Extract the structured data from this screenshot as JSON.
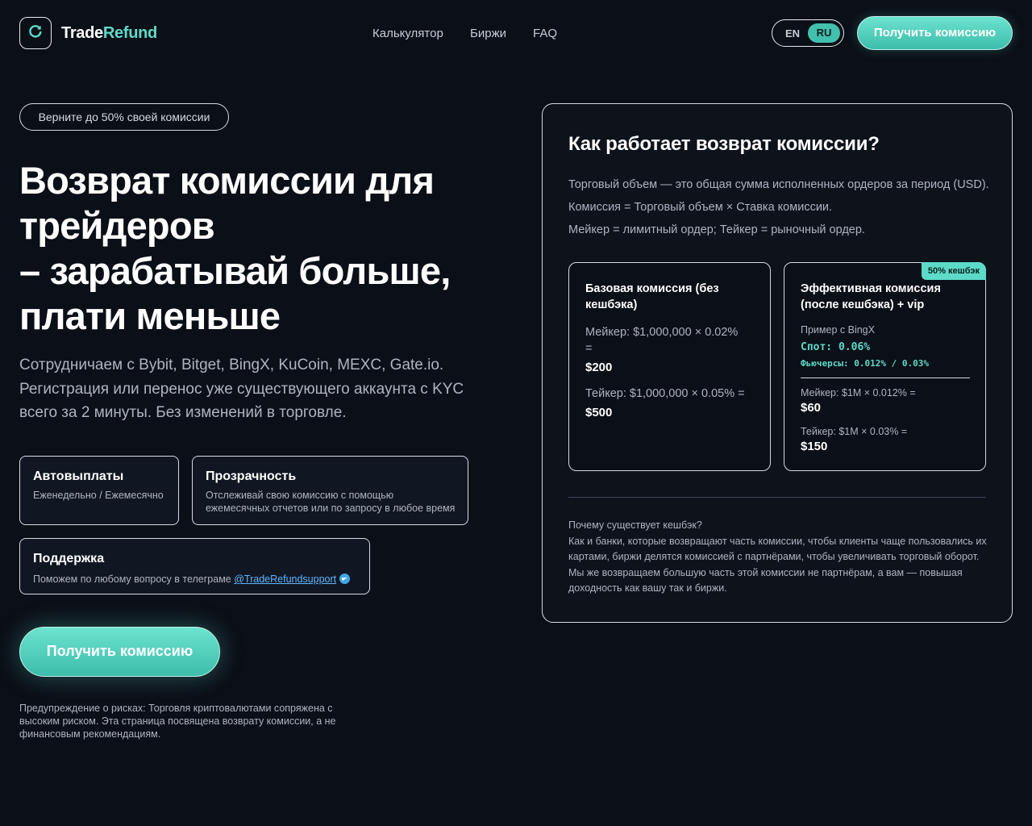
{
  "header": {
    "logo_icon": "refresh-icon",
    "logo_word1": "Trade",
    "logo_word2": "Refund",
    "nav": [
      "Калькулятор",
      "Биржи",
      "FAQ"
    ],
    "lang_en": "EN",
    "lang_ru": "RU",
    "cta": "Получить комиссию"
  },
  "colors": {
    "accent": "#5ddbc9",
    "background": "#0b0f17",
    "link": "#5db7ff"
  },
  "hero": {
    "badge": "Верните до 50% своей комиссии",
    "title_lines": [
      "Возврат комиссии для",
      "трейдеров",
      "– зарабатывай больше,",
      "плати меньше"
    ],
    "subtitle_lines": [
      "Сотрудничаем с Bybit, Bitget, BingX, KuCoin, MEXC, Gate.io.",
      "Регистрация или перенос уже существующего аккаунта с KYC",
      "всего за 2 минуты. Без изменений в торговле."
    ],
    "features": [
      {
        "title": "Автовыплаты",
        "subtitle": "Еженедельно / Ежемесячно"
      },
      {
        "title": "Прозрачность",
        "subtitle_lines": [
          "Отслеживай свою комиссию с помощью",
          "ежемесячных отчетов или по запросу в любое время"
        ]
      },
      {
        "title": "Поддержка",
        "subtitle": "Поможем по любому вопросу в телеграме",
        "link": "@TradeRefundsupport",
        "link_icon": "telegram-icon"
      }
    ],
    "cta": "Получить комиссию",
    "risk_lines": [
      "Предупреждение о рисках: Торговля криптовалютами сопряжена с",
      "высоким риском. Эта страница посвящена возврату комиссии, а не",
      "финансовым рекомендациям."
    ]
  },
  "panel": {
    "title": "Как работает возврат комиссии?",
    "lines": [
      "Торговый объем — это общая сумма исполненных ордеров за период (USD).",
      "Комиссия = Торговый объем × Ставка комиссии.",
      "Мейкер = лимитный ордер; Тейкер = рыночный ордер."
    ],
    "base_card": {
      "title_lines": [
        "Базовая комиссия (без",
        "кешбэка)"
      ],
      "maker_lines": [
        "Мейкер: $1,000,000 × 0.02%",
        "="
      ],
      "maker_value": "$200",
      "taker_line": "Тейкер: $1,000,000 × 0.05% =",
      "taker_value": "$500"
    },
    "effective_card": {
      "tag": "50% кешбэк",
      "title_lines": [
        "Эффективная комиссия",
        "(после кешбэка) + vip"
      ],
      "example": "Пример с BingX",
      "spot": "Спот: 0.06%",
      "futures": "Фьючерсы: 0.012% / 0.03%",
      "maker_line": "Мейкер: $1M × 0.012% =",
      "maker_value": "$60",
      "taker_line": "Тейкер: $1M × 0.03% =",
      "taker_value": "$150"
    },
    "why_title": "Почему существует кешбэк?",
    "why_lines": [
      "Как и банки, которые возвращают часть комиссии, чтобы клиенты чаще пользовались их",
      "картами, биржи делятся комиссией с партнёрами, чтобы увеличивать торговый оборот.",
      "Мы же возвращаем большую часть этой комиссии не партнёрам, а вам — повышая",
      "доходность как вашу так и биржи."
    ]
  }
}
